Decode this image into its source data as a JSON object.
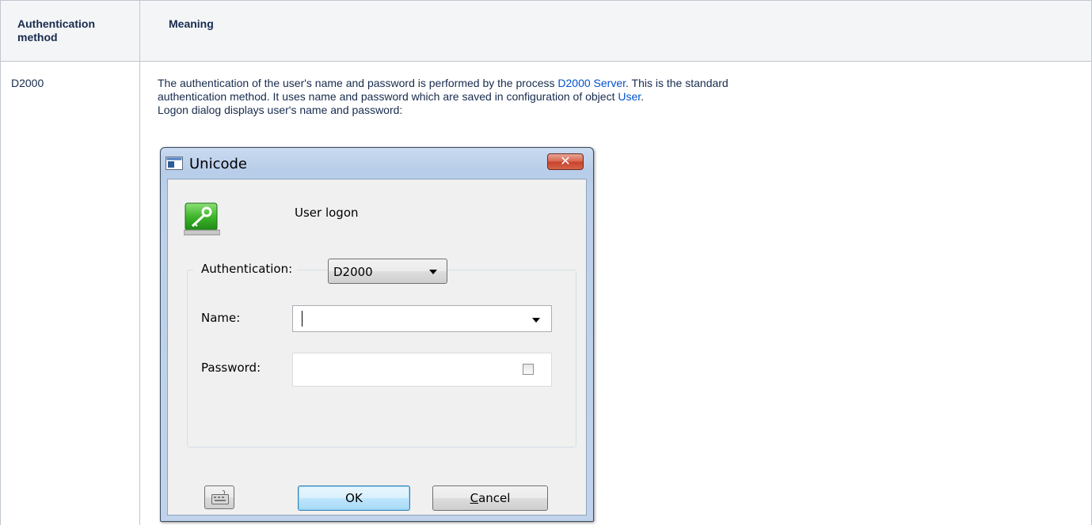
{
  "table": {
    "headers": [
      "Authentication\nmethod",
      "Meaning"
    ],
    "header_col1_line1": "Authentication",
    "header_col1_line2": "method",
    "header_col2": "Meaning",
    "row": {
      "method": "D2000",
      "line1_pre": "The authentication of the user's name and password is performed by the process ",
      "line1_link": "D2000 Server",
      "line1_post": ". This is the standard",
      "line2_pre": "authentication method. It uses name and password which are saved in configuration of object ",
      "line2_link": "User",
      "line2_post": ".",
      "line3": "Logon dialog displays user's name and password:"
    }
  },
  "dialog": {
    "title": "Unicode",
    "close_symbol": "✕",
    "heading": "User logon",
    "auth_label": "Authentication:",
    "auth_value": "D2000",
    "name_label": "Name:",
    "name_value": "",
    "password_label": "Password:",
    "password_value": "",
    "ok_label": "OK",
    "cancel_label_underlined": "C",
    "cancel_label_rest": "ancel",
    "icons": {
      "title": "app-window-icon",
      "logon": "key-icon",
      "keyboard": "keyboard-icon"
    }
  },
  "colors": {
    "link": "#0052cc",
    "header_bg": "#f4f5f7",
    "border": "#c1c7d0"
  }
}
